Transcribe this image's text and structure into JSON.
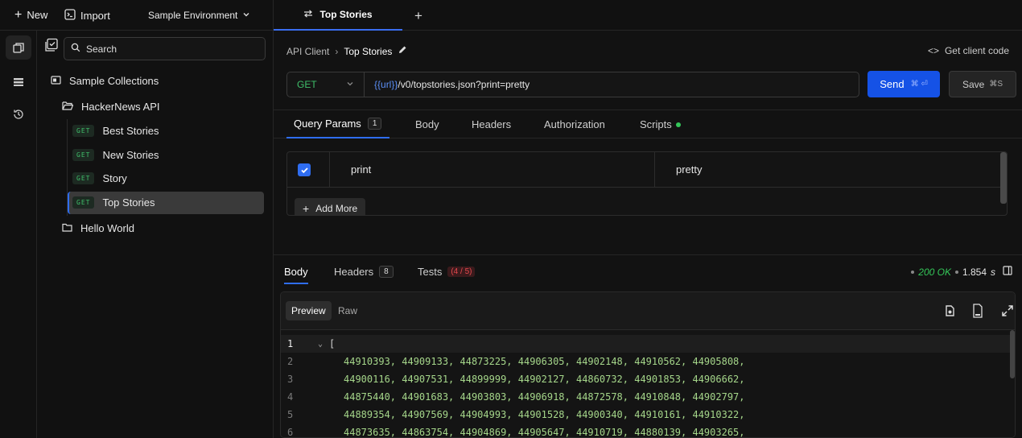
{
  "topbar": {
    "new_label": "New",
    "import_label": "Import",
    "environment": "Sample Environment"
  },
  "sidebar": {
    "search_placeholder": "Search",
    "items": [
      {
        "label": "Sample Collections",
        "type": "collection"
      },
      {
        "label": "HackerNews API",
        "type": "folder-open"
      },
      {
        "method": "GET",
        "label": "Best Stories"
      },
      {
        "method": "GET",
        "label": "New Stories"
      },
      {
        "method": "GET",
        "label": "Story"
      },
      {
        "method": "GET",
        "label": "Top Stories",
        "active": true
      },
      {
        "label": "Hello World",
        "type": "folder"
      }
    ]
  },
  "tabs": [
    {
      "label": "Top Stories",
      "active": true
    }
  ],
  "breadcrumb": {
    "root": "API Client",
    "current": "Top Stories"
  },
  "client_code_label": "Get client code",
  "request": {
    "method": "GET",
    "url_var": "{{url}}",
    "url_path": "/v0/topstories.json?print=pretty",
    "send_label": "Send",
    "send_shortcut": "⌘ ⏎",
    "save_label": "Save",
    "save_shortcut": "⌘S"
  },
  "request_tabs": {
    "query_params": "Query Params",
    "query_params_count": "1",
    "body": "Body",
    "headers": "Headers",
    "authorization": "Authorization",
    "scripts": "Scripts"
  },
  "params": [
    {
      "key": "print",
      "value": "pretty",
      "enabled": true
    }
  ],
  "add_more_label": "Add More",
  "response": {
    "tabs": {
      "body": "Body",
      "headers": "Headers",
      "headers_count": "8",
      "tests": "Tests",
      "tests_count": "(4 / 5)"
    },
    "status": "200 OK",
    "time": "1.854",
    "time_unit": "s",
    "view_modes": {
      "preview": "Preview",
      "raw": "Raw"
    },
    "lines": [
      {
        "n": "1",
        "text": "["
      },
      {
        "n": "2",
        "text": "44910393, 44909133, 44873225, 44906305, 44902148, 44910562, 44905808,"
      },
      {
        "n": "3",
        "text": "44900116, 44907531, 44899999, 44902127, 44860732, 44901853, 44906662,"
      },
      {
        "n": "4",
        "text": "44875440, 44901683, 44903803, 44906918, 44872578, 44910848, 44902797,"
      },
      {
        "n": "5",
        "text": "44889354, 44907569, 44904993, 44901528, 44900340, 44910161, 44910322,"
      },
      {
        "n": "6",
        "text": "44873635, 44863754, 44904869, 44905647, 44910719, 44880139, 44903265,"
      }
    ]
  },
  "colors": {
    "accent": "#1552e6",
    "get": "#3fbf6a",
    "ok": "#34c759",
    "tests": "#e5484d"
  }
}
